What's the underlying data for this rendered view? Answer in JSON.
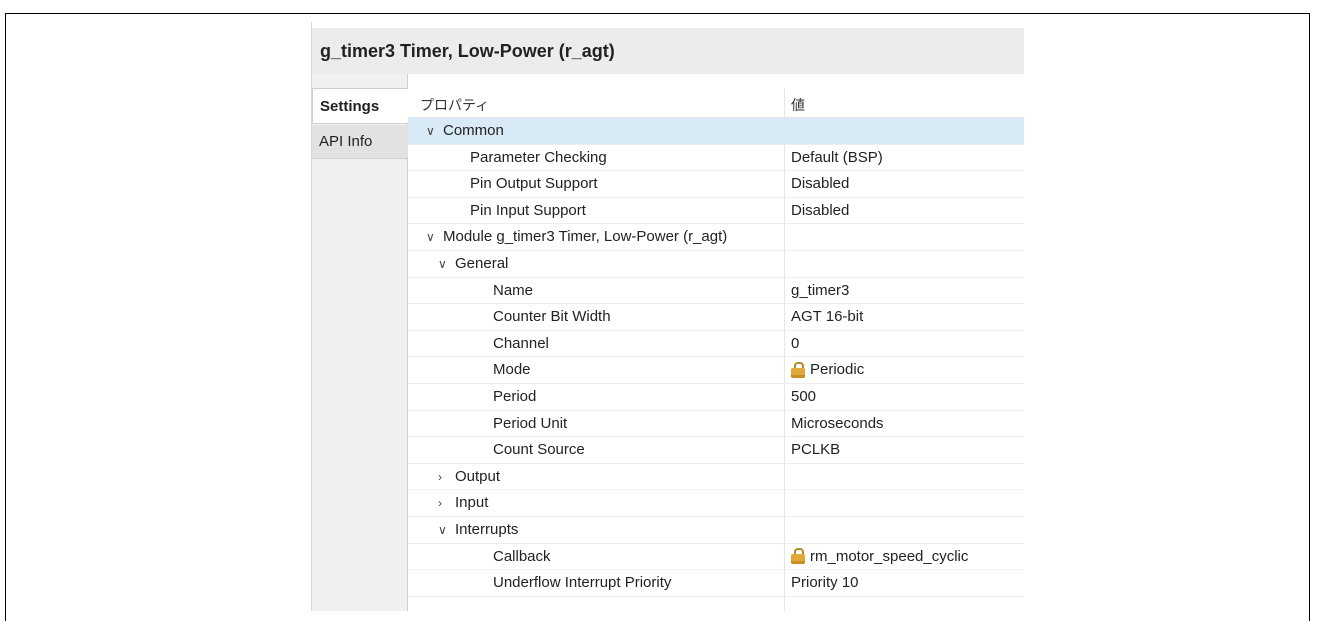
{
  "title": "g_timer3 Timer, Low-Power (r_agt)",
  "tabs": [
    {
      "label": "Settings",
      "active": true
    },
    {
      "label": "API Info",
      "active": false
    }
  ],
  "table": {
    "header": {
      "property": "プロパティ",
      "value": "値"
    },
    "rows": [
      {
        "property": "Common",
        "value": "",
        "expander": "expanded",
        "selected": true
      },
      {
        "property": "Parameter Checking",
        "value": "Default (BSP)"
      },
      {
        "property": "Pin Output Support",
        "value": "Disabled"
      },
      {
        "property": "Pin Input Support",
        "value": "Disabled"
      },
      {
        "property": "Module g_timer3 Timer, Low-Power (r_agt)",
        "value": "",
        "expander": "expanded"
      },
      {
        "property": "General",
        "value": "",
        "expander": "expanded"
      },
      {
        "property": "Name",
        "value": "g_timer3"
      },
      {
        "property": "Counter Bit Width",
        "value": "AGT 16-bit"
      },
      {
        "property": "Channel",
        "value": "0"
      },
      {
        "property": "Mode",
        "value": "Periodic",
        "icon": "lock-icon"
      },
      {
        "property": "Period",
        "value": "500"
      },
      {
        "property": "Period Unit",
        "value": "Microseconds"
      },
      {
        "property": "Count Source",
        "value": "PCLKB"
      },
      {
        "property": "Output",
        "value": "",
        "expander": "collapsed"
      },
      {
        "property": "Input",
        "value": "",
        "expander": "collapsed"
      },
      {
        "property": "Interrupts",
        "value": "",
        "expander": "expanded"
      },
      {
        "property": "Callback",
        "value": "rm_motor_speed_cyclic",
        "icon": "lock-icon"
      },
      {
        "property": "Underflow Interrupt Priority",
        "value": "Priority 10"
      }
    ]
  },
  "colors": {
    "selected_row": "#d9eaf7",
    "lock": "#e0a93a"
  }
}
